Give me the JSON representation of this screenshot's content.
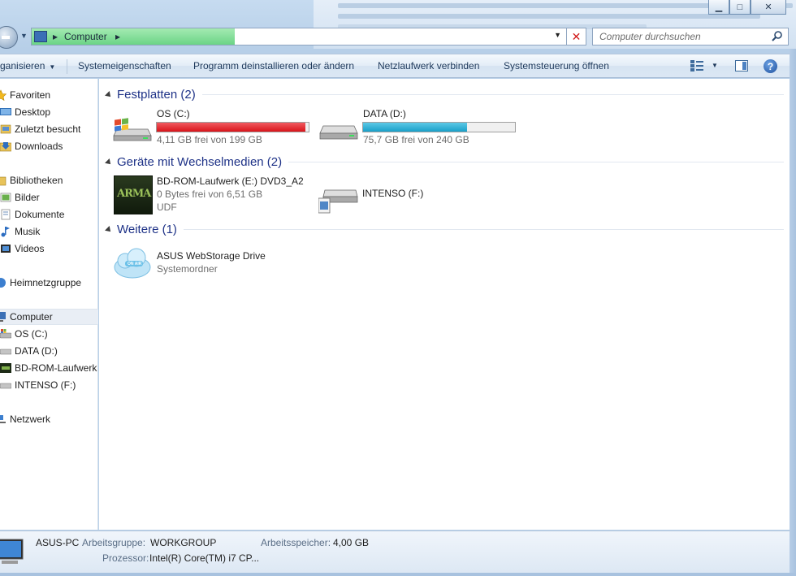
{
  "window": {
    "minimize_glyph": "▁",
    "maximize_glyph": "□",
    "close_glyph": "✕"
  },
  "address": {
    "crumb_separator": "▸",
    "crumb": "Computer",
    "progress": 0.38
  },
  "search": {
    "placeholder": "Computer durchsuchen"
  },
  "commands": {
    "organize": "ganisieren",
    "system_properties": "Systemeigenschaften",
    "uninstall": "Programm deinstallieren oder ändern",
    "map_drive": "Netzlaufwerk verbinden",
    "control_panel": "Systemsteuerung öffnen",
    "help": "?"
  },
  "sidebar": {
    "favorites": "Favoriten",
    "desktop": "Desktop",
    "recent": "Zuletzt besucht",
    "downloads": "Downloads",
    "libraries": "Bibliotheken",
    "pictures": "Bilder",
    "documents": "Dokumente",
    "music": "Musik",
    "videos": "Videos",
    "homegroup": "Heimnetzgruppe",
    "computer": "Computer",
    "drive_c": "OS (C:)",
    "drive_d": "DATA (D:)",
    "drive_e": "BD-ROM-Laufwerk",
    "drive_f": "INTENSO (F:)",
    "network": "Netzwerk"
  },
  "groups": {
    "hard_disks": "Festplatten (2)",
    "removable": "Geräte mit Wechselmedien (2)",
    "other": "Weitere (1)"
  },
  "drives": {
    "c": {
      "name": "OS (C:)",
      "free": "4,11 GB frei von 199 GB",
      "used_fraction": 0.979,
      "color": "#d8141b"
    },
    "d": {
      "name": "DATA (D:)",
      "free": "75,7 GB frei von 240 GB",
      "used_fraction": 0.685,
      "color": "#1aa0c8"
    },
    "e": {
      "name": "BD-ROM-Laufwerk (E:) DVD3_A2",
      "free": "0 Bytes frei von 6,51 GB",
      "fs": "UDF",
      "disc_label": "ARMA"
    },
    "f": {
      "name": "INTENSO (F:)"
    }
  },
  "other": {
    "asus": {
      "name": "ASUS WebStorage Drive",
      "type": "Systemordner",
      "badge": "ON AIR"
    }
  },
  "details": {
    "pc_name": "ASUS-PC",
    "workgroup_label": "Arbeitsgruppe:",
    "workgroup": "WORKGROUP",
    "memory_label": "Arbeitsspeicher:",
    "memory": "4,00 GB",
    "cpu_label": "Prozessor:",
    "cpu": "Intel(R) Core(TM) i7 CP..."
  },
  "colors": {
    "accent": "#1e3287",
    "selection": "#e9eef5"
  }
}
